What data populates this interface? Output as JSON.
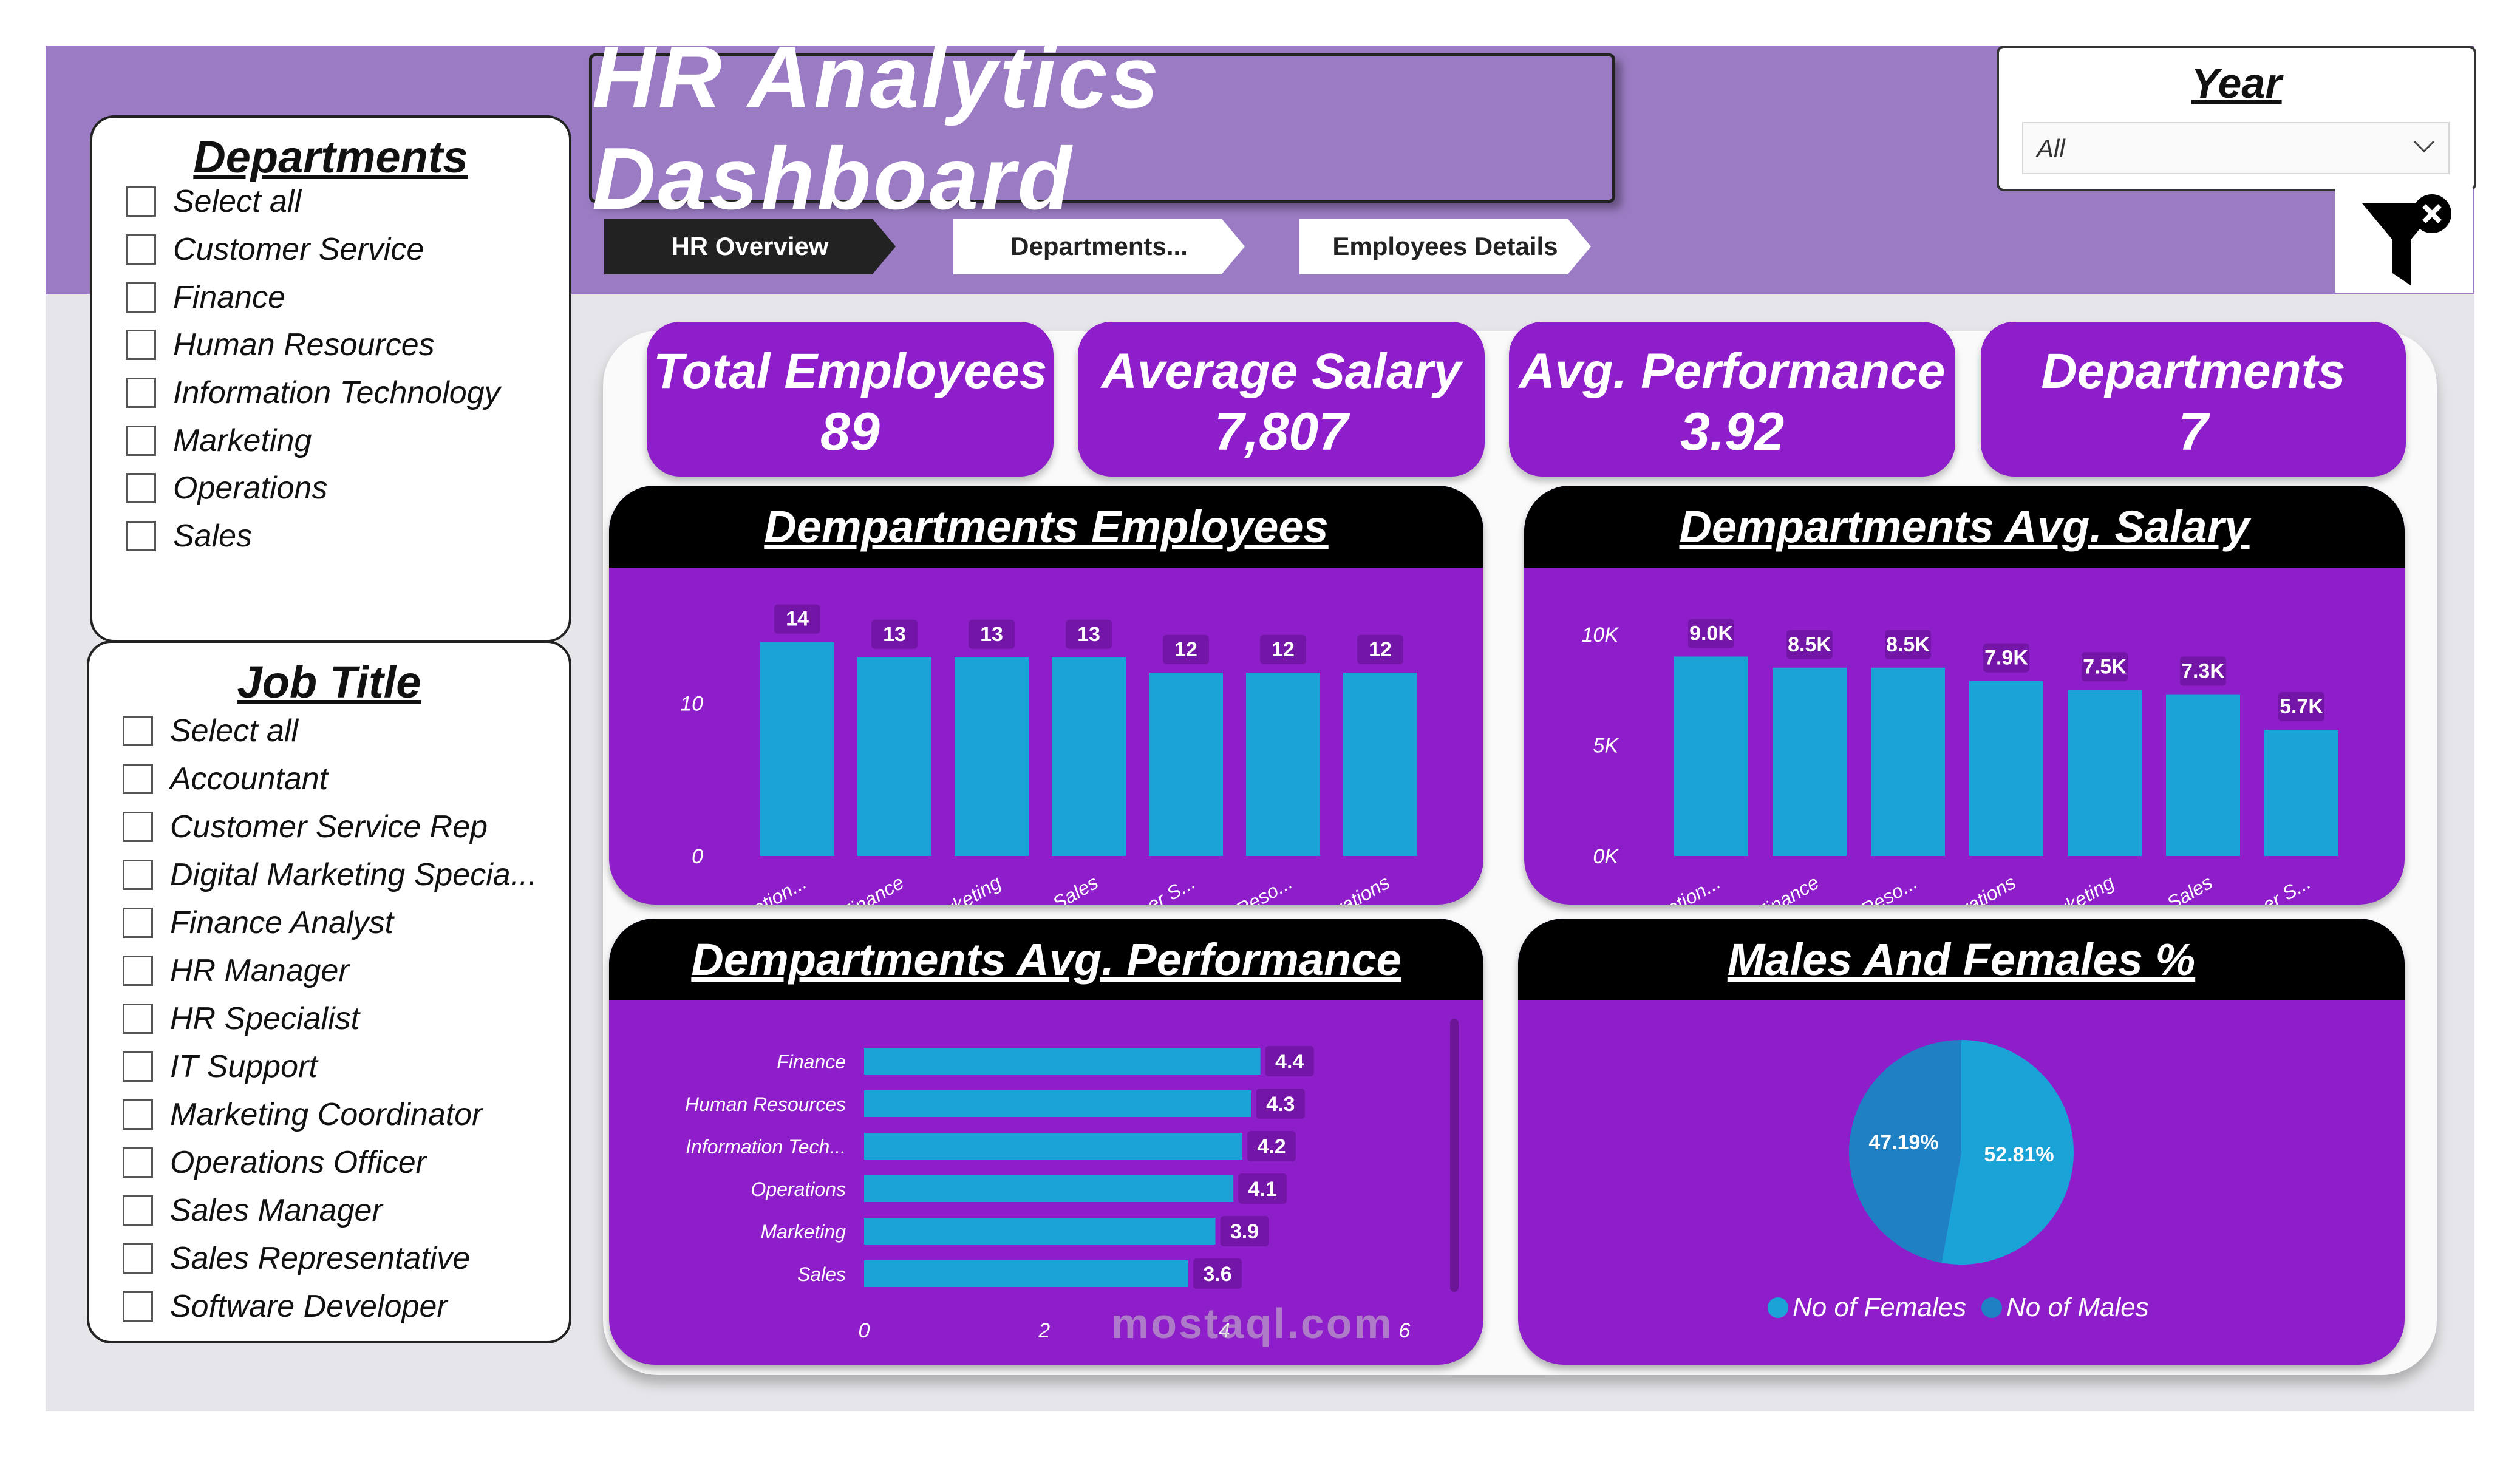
{
  "header": {
    "title": "HR Analytics Dashboard",
    "nav": [
      "HR Overview",
      "Departments...",
      "Employees Details"
    ]
  },
  "year_slicer": {
    "title": "Year",
    "selected": "All"
  },
  "departments_slicer": {
    "title": "Departments",
    "items": [
      "Select all",
      "Customer Service",
      "Finance",
      "Human Resources",
      "Information Technology",
      "Marketing",
      "Operations",
      "Sales"
    ]
  },
  "job_title_slicer": {
    "title": "Job Title",
    "items": [
      "Select all",
      "Accountant",
      "Customer Service Rep",
      "Digital Marketing Specia...",
      "Finance Analyst",
      "HR Manager",
      "HR Specialist",
      "IT Support",
      "Marketing Coordinator",
      "Operations Officer",
      "Sales Manager",
      "Sales Representative",
      "Software Developer"
    ]
  },
  "kpis": {
    "total_employees": {
      "label": "Total Employees",
      "value": "89"
    },
    "average_salary": {
      "label": "Average Salary",
      "value": "7,807"
    },
    "avg_performance": {
      "label": "Avg. Performance",
      "value": "3.92"
    },
    "departments": {
      "label": "Departments",
      "value": "7"
    }
  },
  "colors": {
    "card": "#8e1ec9",
    "bar": "#1aa3d6",
    "header": "#9b7cc4",
    "female": "#1f80c4",
    "male": "#1aa3d6"
  },
  "chart_data": [
    {
      "type": "bar",
      "title": "Dempartments Employees",
      "categories": [
        "Information...",
        "Finance",
        "Marketing",
        "Sales",
        "Customer S...",
        "Human Reso...",
        "Operations"
      ],
      "values": [
        14,
        13,
        13,
        13,
        12,
        12,
        12
      ],
      "data_labels": [
        "14",
        "13",
        "13",
        "13",
        "12",
        "12",
        "12"
      ],
      "ytick_labels": [
        "0",
        "10"
      ],
      "ylim": [
        0,
        14.5
      ]
    },
    {
      "type": "bar",
      "title": "Dempartments Avg. Salary",
      "categories": [
        "Information...",
        "Finance",
        "Human Reso...",
        "Operations",
        "Marketing",
        "Sales",
        "Customer S..."
      ],
      "values": [
        9000,
        8500,
        8500,
        7900,
        7500,
        7300,
        5700
      ],
      "data_labels": [
        "9.0K",
        "8.5K",
        "8.5K",
        "7.9K",
        "7.5K",
        "7.3K",
        "5.7K"
      ],
      "ytick_labels": [
        "0K",
        "5K",
        "10K"
      ],
      "ylim": [
        0,
        10000
      ]
    },
    {
      "type": "bar",
      "orientation": "horizontal",
      "title": "Dempartments Avg. Performance",
      "categories": [
        "Finance",
        "Human Resources",
        "Information Tech...",
        "Operations",
        "Marketing",
        "Sales"
      ],
      "values": [
        4.4,
        4.3,
        4.2,
        4.1,
        3.9,
        3.6
      ],
      "data_labels": [
        "4.4",
        "4.3",
        "4.2",
        "4.1",
        "3.9",
        "3.6"
      ],
      "xtick_labels": [
        "0",
        "2",
        "4",
        "6"
      ],
      "xlim": [
        0,
        6
      ]
    },
    {
      "type": "pie",
      "title": "Males And Females %",
      "labels": [
        "No of Females",
        "No of Males"
      ],
      "values": [
        47.19,
        52.81
      ],
      "data_labels": [
        "47.19%",
        "52.81%"
      ],
      "legend": "bottom"
    }
  ],
  "watermark": "mostaql.com"
}
